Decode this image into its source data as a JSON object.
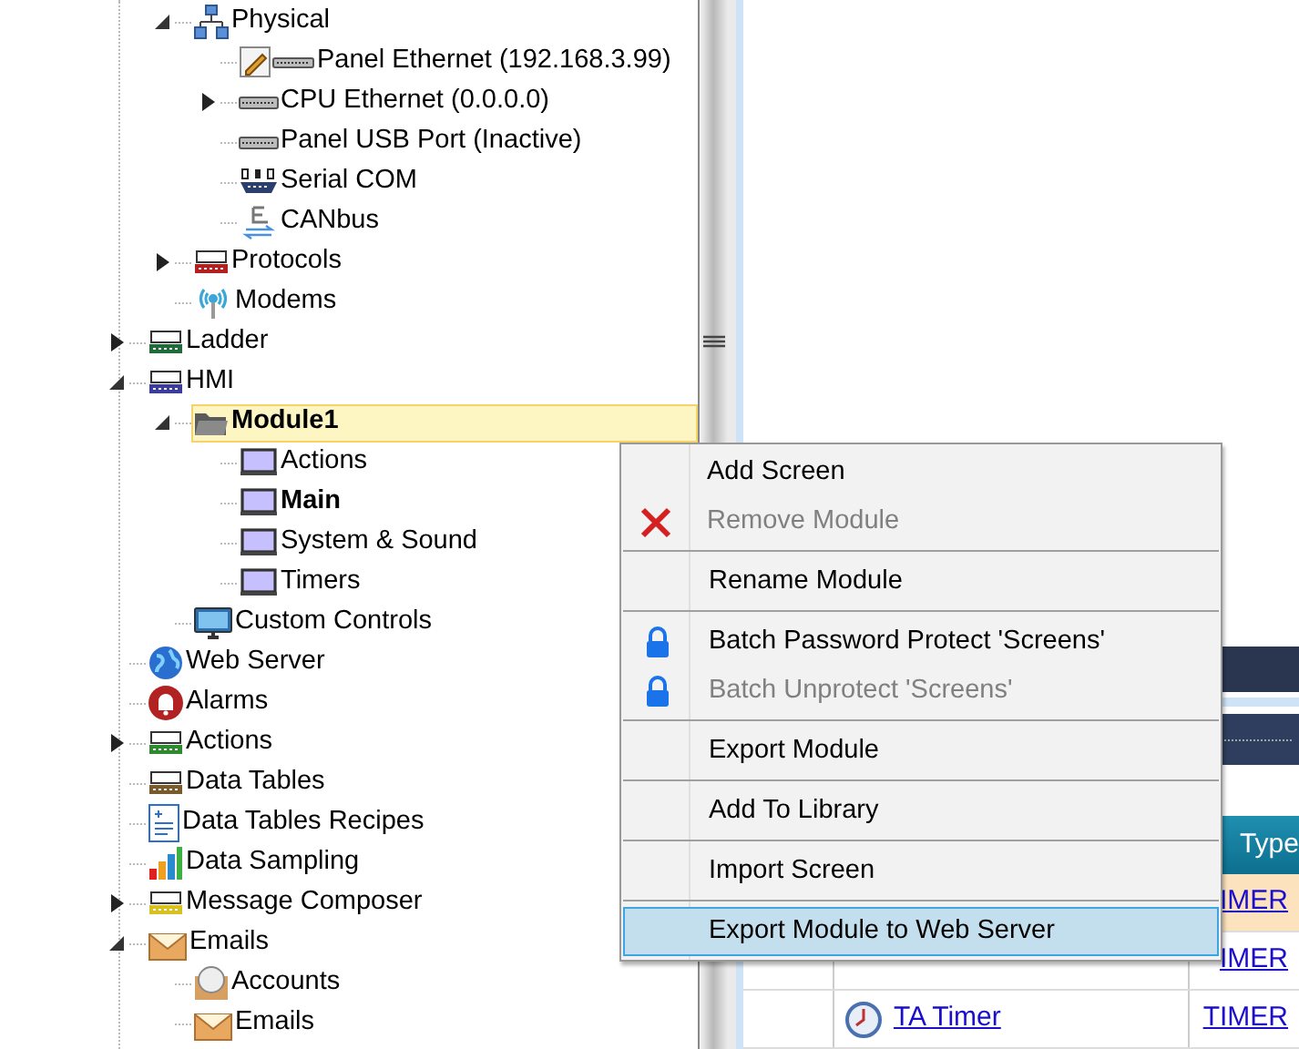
{
  "tree": {
    "continued_children": [
      {
        "label": "Physical",
        "kind": "network",
        "expanded": true,
        "selected": false,
        "bold": false,
        "children": [
          {
            "label": "Panel Ethernet (192.168.3.99)",
            "kind": "edit-port",
            "selected": false,
            "bold": false
          },
          {
            "label": "CPU Ethernet (0.0.0.0)",
            "kind": "port",
            "expanded": false,
            "selected": false,
            "bold": false
          },
          {
            "label": "Panel USB Port (Inactive)",
            "kind": "port",
            "selected": false,
            "bold": false
          },
          {
            "label": "Serial COM",
            "kind": "serial",
            "selected": false,
            "bold": false
          },
          {
            "label": "CANbus",
            "kind": "canbus",
            "selected": false,
            "bold": false
          }
        ]
      },
      {
        "label": "Protocols",
        "kind": "protocol",
        "expanded": false,
        "selected": false,
        "bold": false
      },
      {
        "label": "Modems",
        "kind": "modem",
        "selected": false,
        "bold": false
      }
    ],
    "items": [
      {
        "label": "Ladder",
        "kind": "ladder",
        "expanded": false,
        "selected": false,
        "bold": false
      },
      {
        "label": "HMI",
        "kind": "hmi",
        "expanded": true,
        "selected": false,
        "bold": false,
        "children": [
          {
            "label": "Module1",
            "kind": "folder",
            "expanded": true,
            "selected": true,
            "bold": true,
            "children": [
              {
                "label": "Actions",
                "kind": "screen",
                "selected": false,
                "bold": false
              },
              {
                "label": "Main",
                "kind": "screen",
                "selected": false,
                "bold": true
              },
              {
                "label": "System & Sound",
                "kind": "screen",
                "selected": false,
                "bold": false
              },
              {
                "label": "Timers",
                "kind": "screen",
                "selected": false,
                "bold": false
              }
            ]
          },
          {
            "label": "Custom Controls",
            "kind": "monitor",
            "selected": false,
            "bold": false
          }
        ]
      },
      {
        "label": "Web Server",
        "kind": "globe",
        "selected": false,
        "bold": false
      },
      {
        "label": "Alarms",
        "kind": "alarm",
        "selected": false,
        "bold": false
      },
      {
        "label": "Actions",
        "kind": "actions",
        "expanded": false,
        "selected": false,
        "bold": false
      },
      {
        "label": "Data Tables",
        "kind": "table",
        "selected": false,
        "bold": false
      },
      {
        "label": "Data Tables Recipes",
        "kind": "recipe",
        "selected": false,
        "bold": false
      },
      {
        "label": "Data Sampling",
        "kind": "chart",
        "selected": false,
        "bold": false
      },
      {
        "label": "Message Composer",
        "kind": "message",
        "expanded": false,
        "selected": false,
        "bold": false
      },
      {
        "label": "Emails",
        "kind": "mail",
        "expanded": true,
        "selected": false,
        "bold": false,
        "children": [
          {
            "label": "Accounts",
            "kind": "account",
            "selected": false,
            "bold": false
          },
          {
            "label": "Emails",
            "kind": "mail",
            "selected": false,
            "bold": false
          }
        ]
      }
    ]
  },
  "table": {
    "header": {
      "column_3": "Type"
    },
    "rows": [
      {
        "column_2": "",
        "column_3": "IMER",
        "selected": true
      },
      {
        "column_2": "",
        "column_3": "IMER",
        "selected": false
      },
      {
        "column_2": "TA Timer",
        "column_3": "TIMER",
        "selected": false
      }
    ]
  },
  "context_menu": {
    "groups": [
      [
        {
          "label": "Add Screen",
          "kind": "plain",
          "disabled": false,
          "selected": false
        },
        {
          "label": "Remove Module",
          "kind": "delete",
          "disabled": true,
          "selected": false
        }
      ],
      [
        {
          "label": "Rename Module",
          "kind": "plain",
          "disabled": false,
          "selected": false
        }
      ],
      [
        {
          "label": "Batch Password Protect 'Screens'",
          "kind": "lock",
          "disabled": false,
          "selected": false
        },
        {
          "label": "Batch Unprotect 'Screens'",
          "kind": "lock",
          "disabled": true,
          "selected": false
        }
      ],
      [
        {
          "label": "Export Module",
          "kind": "plain",
          "disabled": false,
          "selected": false
        }
      ],
      [
        {
          "label": "Add To Library",
          "kind": "plain",
          "disabled": false,
          "selected": false
        }
      ],
      [
        {
          "label": "Import Screen",
          "kind": "plain",
          "disabled": false,
          "selected": false
        }
      ],
      [
        {
          "label": "Export Module to Web Server",
          "kind": "plain",
          "disabled": false,
          "selected": true
        }
      ]
    ]
  }
}
